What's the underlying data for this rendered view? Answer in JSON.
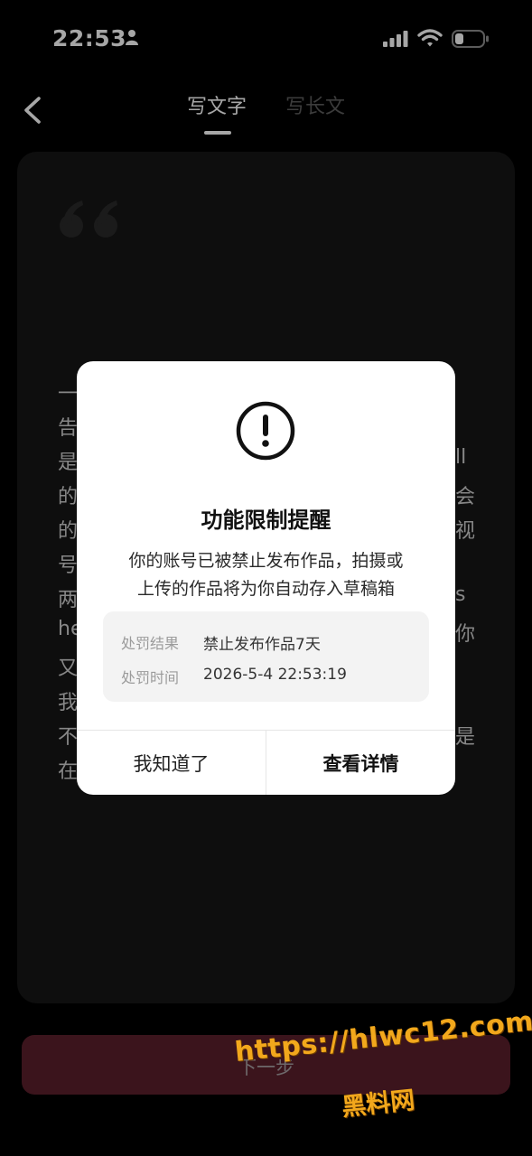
{
  "status_bar": {
    "time": "22:53",
    "icons": [
      "person-icon",
      "signal-icon",
      "wifi-icon",
      "battery-icon"
    ]
  },
  "header": {
    "back_icon": "chevron-left-icon",
    "tabs": [
      {
        "label": "写文字",
        "active": true
      },
      {
        "label": "写长文",
        "active": false
      }
    ]
  },
  "editor": {
    "quote_icon": "quote-icon",
    "visible_left_chars": [
      "一",
      "告",
      "是",
      "的",
      "的",
      "号",
      "两",
      "he",
      "又",
      "我",
      "不",
      "在"
    ],
    "visible_right_chars": [
      "ll",
      "会",
      "视",
      "s",
      "你",
      "是"
    ]
  },
  "footer": {
    "next_label": "下一步",
    "accent_color": "#5b1f2c"
  },
  "modal": {
    "icon": "exclamation-circle-icon",
    "title": "功能限制提醒",
    "body_line1": "你的账号已被禁止发布作品，拍摄或",
    "body_line2": "上传的作品将为你自动存入草稿箱",
    "details": [
      {
        "label": "处罚结果",
        "value": "禁止发布作品7天"
      },
      {
        "label": "处罚时间",
        "value": "2026-5-4 22:53:19"
      }
    ],
    "button_ack": "我知道了",
    "button_detail": "查看详情"
  },
  "watermark": {
    "url": "https://hlwc12.com",
    "brand": "黑料网",
    "color": "#f2a81c"
  }
}
